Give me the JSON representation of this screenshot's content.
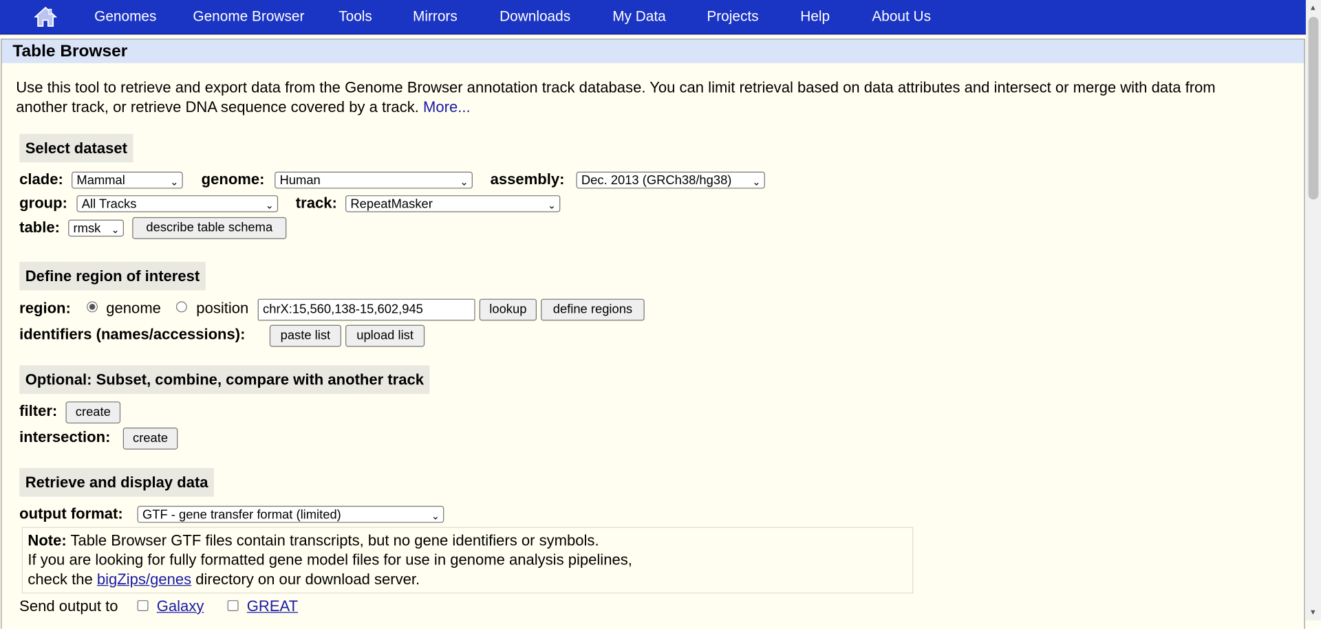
{
  "nav": {
    "items": [
      "Genomes",
      "Genome Browser",
      "Tools",
      "Mirrors",
      "Downloads",
      "My Data",
      "Projects",
      "Help",
      "About Us"
    ]
  },
  "page": {
    "title": "Table Browser",
    "intro": "Use this tool to retrieve and export data from the Genome Browser annotation track database. You can limit retrieval based on data attributes and intersect or merge with data from another track, or retrieve DNA sequence covered by a track.",
    "more_link": "More..."
  },
  "dataset": {
    "header": "Select dataset",
    "clade_label": "clade:",
    "clade_value": "Mammal",
    "genome_label": "genome:",
    "genome_value": "Human",
    "assembly_label": "assembly:",
    "assembly_value": "Dec. 2013 (GRCh38/hg38)",
    "group_label": "group:",
    "group_value": "All Tracks",
    "track_label": "track:",
    "track_value": "RepeatMasker",
    "table_label": "table:",
    "table_value": "rmsk",
    "describe_button": "describe table schema"
  },
  "region": {
    "header": "Define region of interest",
    "region_label": "region:",
    "genome_option": "genome",
    "position_option": "position",
    "position_value": "chrX:15,560,138-15,602,945",
    "lookup_button": "lookup",
    "define_regions_button": "define regions",
    "identifiers_label": "identifiers (names/accessions):",
    "paste_button": "paste list",
    "upload_button": "upload list"
  },
  "optional": {
    "header": "Optional: Subset, combine, compare with another track",
    "filter_label": "filter:",
    "filter_button": "create",
    "intersection_label": "intersection:",
    "intersection_button": "create"
  },
  "retrieve": {
    "header": "Retrieve and display data",
    "output_label": "output format:",
    "output_value": "GTF - gene transfer format (limited)",
    "note_bold": "Note:",
    "note_line1": "Table Browser GTF files contain transcripts, but no gene identifiers or symbols.",
    "note_line2": "If you are looking for fully formatted gene model files for use in genome analysis pipelines,",
    "note_line3_pre": "check the",
    "note_link": "bigZips/genes",
    "note_line3_post": "directory on our download server.",
    "send_label": "Send output to",
    "galaxy": "Galaxy",
    "great": "GREAT"
  }
}
